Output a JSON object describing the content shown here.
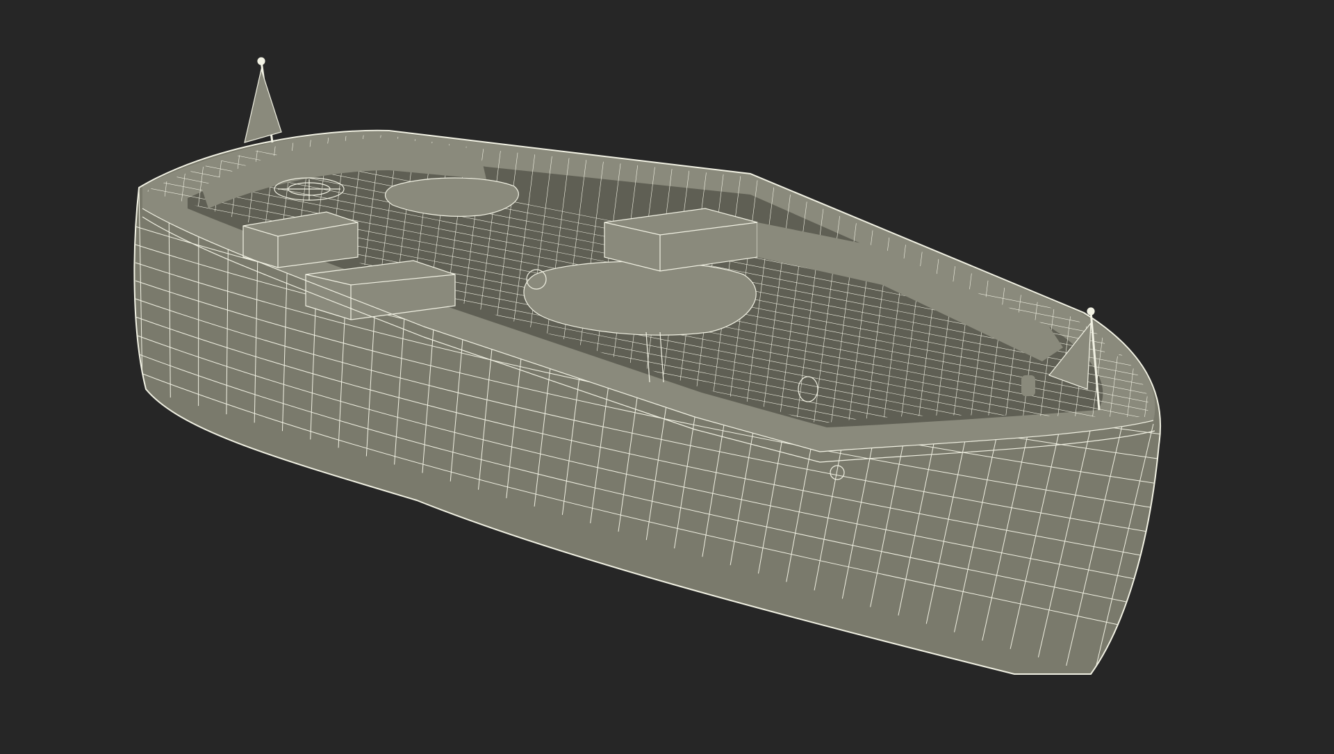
{
  "scene": {
    "background_color": "#262626",
    "hull_fill": "#7a7a6c",
    "interior_fill": "#5f5f54",
    "deck_fill": "#8a8a7c",
    "wire_color": "#f2f2e4"
  }
}
